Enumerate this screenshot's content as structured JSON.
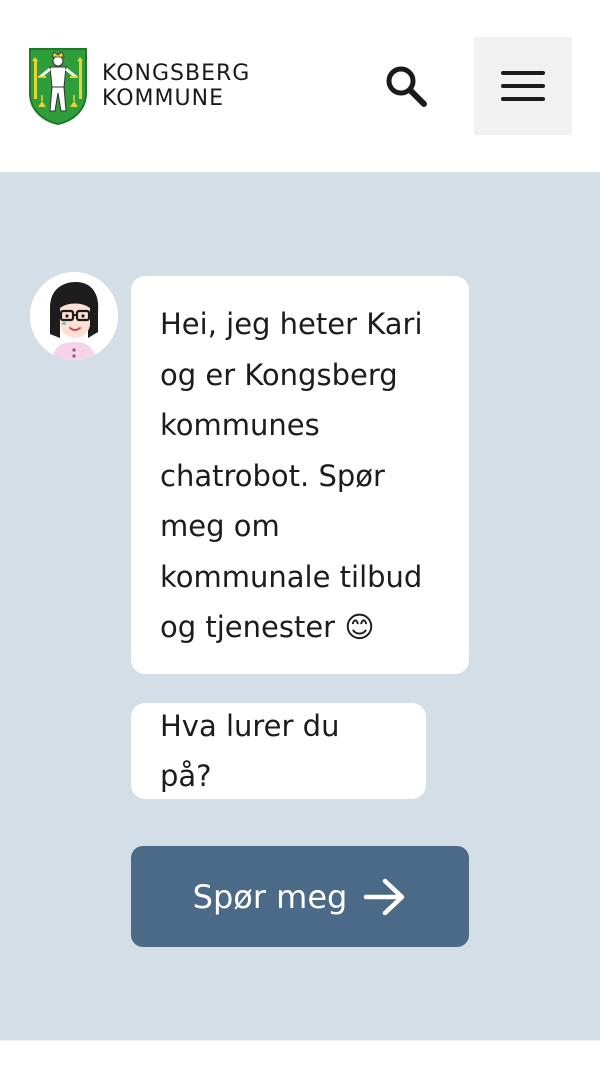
{
  "header": {
    "logo_line1": "KONGSBERG",
    "logo_line2": "KOMMUNE",
    "crest_icon": "kongsberg-coat-of-arms-icon",
    "search_icon": "search-icon",
    "menu_icon": "hamburger-menu-icon"
  },
  "chat": {
    "bot_avatar": "chatbot-avatar-kari",
    "greeting": "Hei, jeg heter Kari og er Kongsberg kommunes chatrobot. Spør meg om kommunale tilbud og tjenester 😊",
    "question": "Hva lurer du på?",
    "ask_button_label": "Spør meg",
    "ask_button_icon": "arrow-right-icon"
  },
  "colors": {
    "chat_background": "#d3dee7",
    "button_background": "#4b6a87",
    "menu_button_background": "#f1f1f1",
    "crest_green": "#2e9e3a",
    "crest_yellow": "#e8d23a"
  }
}
